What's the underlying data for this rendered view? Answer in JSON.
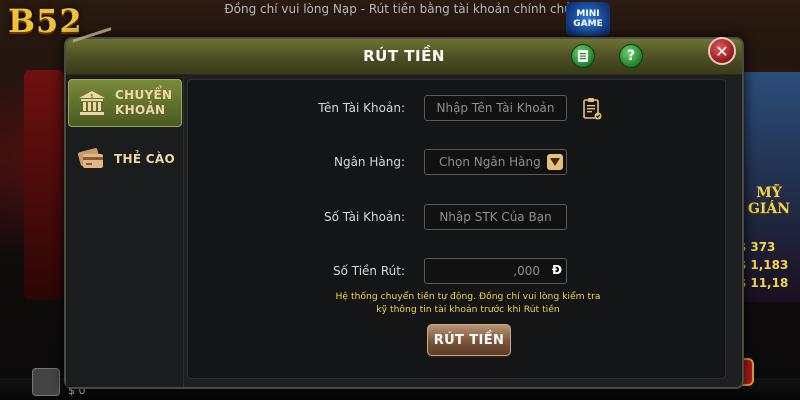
{
  "background": {
    "logo": "B52",
    "marquee": "Đồng chí vui lòng Nạp - Rút tiền bằng tài khoản chính chủ.",
    "minigame_label": "MINI GAME",
    "jackpot_label": "MỸ GIÁN",
    "jackpots": [
      {
        "currency": "$",
        "value": "373"
      },
      {
        "currency": "$",
        "value": "1,183"
      },
      {
        "currency": "$",
        "value": "11,18"
      }
    ],
    "balance": "$ 0"
  },
  "modal": {
    "title": "RÚT TIỀN",
    "history_icon": "history-icon",
    "help_label": "?",
    "close_label": "✕"
  },
  "sidebar": {
    "items": [
      {
        "label_line1": "CHUYỂN",
        "label_line2": "KHOẢN",
        "icon": "bank-icon",
        "active": true
      },
      {
        "label_line1": "THẺ CÀO",
        "label_line2": "",
        "icon": "card-icon",
        "active": false
      }
    ]
  },
  "form": {
    "account_name": {
      "label": "Tên Tài Khoản:",
      "placeholder": "Nhập Tên Tài Khoản"
    },
    "bank": {
      "label": "Ngân Hàng:",
      "value": "Chọn Ngân Hàng"
    },
    "account_number": {
      "label": "Số Tài Khoản:",
      "placeholder": "Nhập STK Của Bạn"
    },
    "amount": {
      "label": "Số Tiền Rút:",
      "placeholder": ",000",
      "currency": "Đ"
    },
    "note_line1": "Hệ thống chuyển tiền tự động. Đồng chí vui lòng kiểm tra",
    "note_line2": "kỹ thông tin tài khoản trước khi Rút tiền",
    "submit_label": "RÚT TIỀN"
  },
  "colors": {
    "header": "#5b5d2a",
    "active_tab": "#6a7a30",
    "note_text": "#f1d24a",
    "submit": "#7a553a"
  }
}
